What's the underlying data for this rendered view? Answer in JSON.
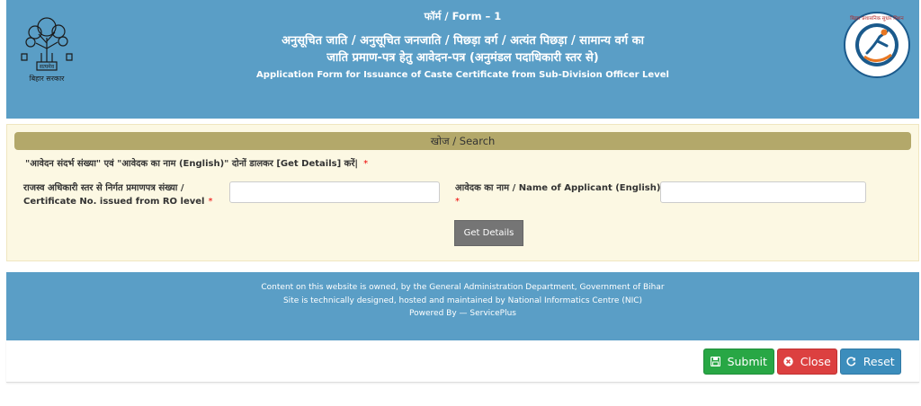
{
  "header": {
    "form_no": "फॉर्म / Form – 1",
    "title_hindi_1": "अनुसूचित जाति / अनुसूचित जनजाति / पिछड़ा वर्ग / अत्यंत पिछड़ा / सामान्य वर्ग का",
    "title_hindi_2": "जाति प्रमाण-पत्र हेतु आवेदन-पत्र (अनुमंडल पदाधिकारी स्तर से)",
    "title_english": "Application Form for Issuance of Caste Certificate from Sub-Division Officer Level",
    "left_logo_caption": "बिहार सरकार",
    "left_logo_emblem_text": "सत्यमेव",
    "right_logo_text": "बिहार प्रशासनिक सुधार मिशन"
  },
  "search": {
    "bar_label": "खोज / Search",
    "instruction": "\"आवेदन संदर्भ संख्या\" एवं \"आवेदक का नाम (English)\" दोनों डालकर [Get Details] करें|",
    "required_mark": "*",
    "cert_label_1": "राजस्व अधिकारी स्तर से निर्गत प्रमाणपत्र संख्या /",
    "cert_label_2": "Certificate No. issued from RO level",
    "cert_value": "",
    "name_label": "आवेदक का नाम / Name of Applicant (English)",
    "name_value": "",
    "get_details": "Get Details"
  },
  "footer": {
    "line1": "Content on this website is owned, by the General Administration Department, Government of Bihar",
    "line2": "Site is technically designed, hosted and maintained by National Informatics Centre (NIC)",
    "line3": "Powered By — ServicePlus"
  },
  "actions": {
    "submit": "Submit",
    "close": "Close",
    "reset": "Reset"
  },
  "colors": {
    "header_bg": "#5a9ec6",
    "search_bar": "#b3a86a",
    "panel_bg": "#fcf8e3",
    "submit": "#28a745",
    "close": "#dc4040",
    "reset": "#3c8dbc"
  }
}
